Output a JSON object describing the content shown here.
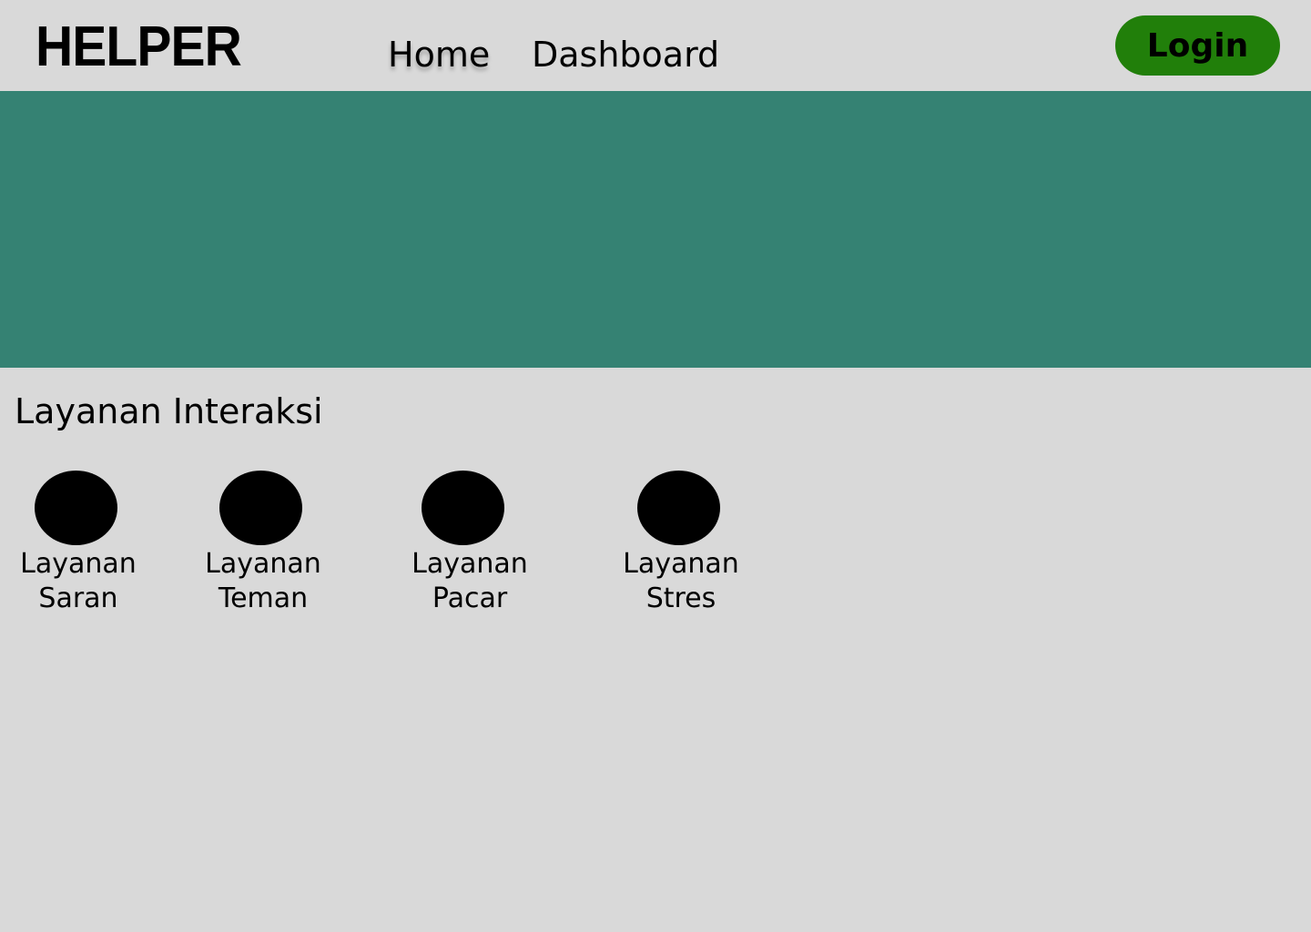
{
  "header": {
    "logo": "HELPER",
    "nav": [
      {
        "label": "Home"
      },
      {
        "label": "Dashboard"
      }
    ],
    "login_label": "Login"
  },
  "colors": {
    "background": "#d9d9d9",
    "hero": "#358273",
    "login_button": "#217f0a"
  },
  "section": {
    "title": "Layanan Interaksi",
    "services": [
      {
        "line1": "Layanan",
        "line2": "Saran",
        "icon": "circle-icon"
      },
      {
        "line1": "Layanan",
        "line2": "Teman",
        "icon": "circle-icon"
      },
      {
        "line1": "Layanan",
        "line2": "Pacar",
        "icon": "circle-icon"
      },
      {
        "line1": "Layanan",
        "line2": "Stres",
        "icon": "circle-icon"
      }
    ]
  }
}
